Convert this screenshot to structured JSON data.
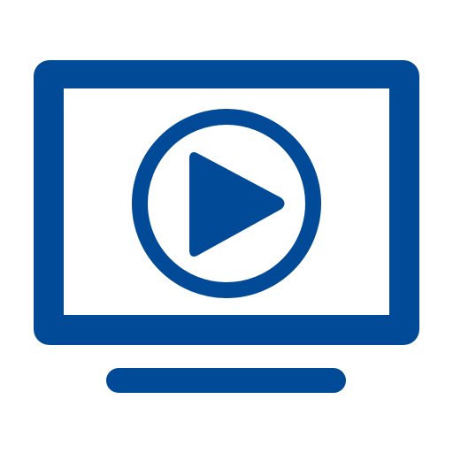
{
  "icon": {
    "name": "video-player-monitor-icon",
    "parts": [
      "monitor-frame",
      "play-circle",
      "play-triangle",
      "monitor-stand"
    ]
  },
  "colors": {
    "primary": "#004a98",
    "background": "#ffffff"
  }
}
